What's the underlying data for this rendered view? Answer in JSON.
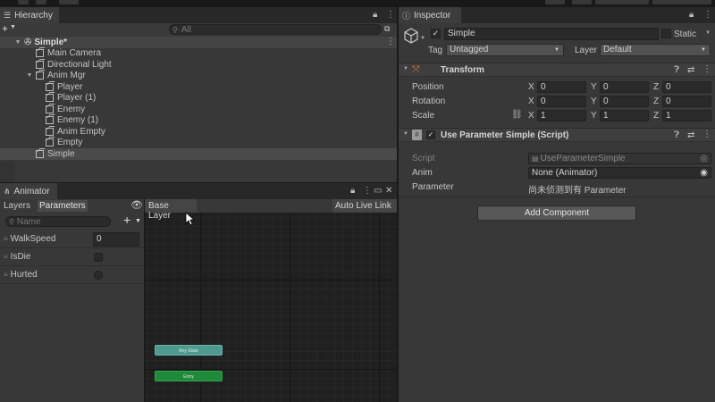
{
  "hierarchy": {
    "tab_label": "Hierarchy",
    "search_placeholder": "All",
    "scene_name": "Simple*",
    "items": [
      {
        "label": "Main Camera"
      },
      {
        "label": "Directional Light"
      },
      {
        "label": "Anim Mgr"
      },
      {
        "label": "Player"
      },
      {
        "label": "Player (1)"
      },
      {
        "label": "Enemy"
      },
      {
        "label": "Enemy (1)"
      },
      {
        "label": "Anim Empty"
      },
      {
        "label": "Empty"
      },
      {
        "label": "Simple"
      }
    ]
  },
  "animator": {
    "tab_label": "Animator",
    "layers_tab": "Layers",
    "parameters_tab": "Parameters",
    "search_placeholder": "Name",
    "base_layer": "Base Layer",
    "auto_live_link": "Auto Live Link",
    "params": [
      {
        "name": "WalkSpeed",
        "value": "0",
        "type": "float"
      },
      {
        "name": "IsDie",
        "type": "bool"
      },
      {
        "name": "Hurted",
        "type": "trigger"
      }
    ],
    "nodes": {
      "any_state": "Any State",
      "entry": "Entry"
    },
    "colors": {
      "any_state": "#4e9a8f",
      "entry": "#1f8a3a"
    }
  },
  "inspector": {
    "tab_label": "Inspector",
    "object_name": "Simple",
    "static_label": "Static",
    "tag_label": "Tag",
    "tag_value": "Untagged",
    "layer_label": "Layer",
    "layer_value": "Default",
    "transform": {
      "title": "Transform",
      "position_label": "Position",
      "rotation_label": "Rotation",
      "scale_label": "Scale",
      "axis_x": "X",
      "axis_y": "Y",
      "axis_z": "Z",
      "position": [
        "0",
        "0",
        "0"
      ],
      "rotation": [
        "0",
        "0",
        "0"
      ],
      "scale": [
        "1",
        "1",
        "1"
      ]
    },
    "script_component": {
      "title": "Use Parameter Simple (Script)",
      "script_label": "Script",
      "script_value": "UseParameterSimple",
      "anim_label": "Anim",
      "anim_value": "None (Animator)",
      "parameter_label": "Parameter",
      "parameter_value": "尚未侦测到有 Parameter"
    },
    "add_component": "Add Component"
  },
  "icons": [
    "hamburger-icon",
    "add-icon",
    "search-icon",
    "lock-icon",
    "kebab-icon",
    "cube-icon",
    "unity-scene-icon",
    "eye-icon",
    "maximize-icon",
    "close-icon",
    "help-icon",
    "settings-sliders-icon",
    "script-icon",
    "link-icon",
    "transform-icon",
    "target-icon"
  ]
}
